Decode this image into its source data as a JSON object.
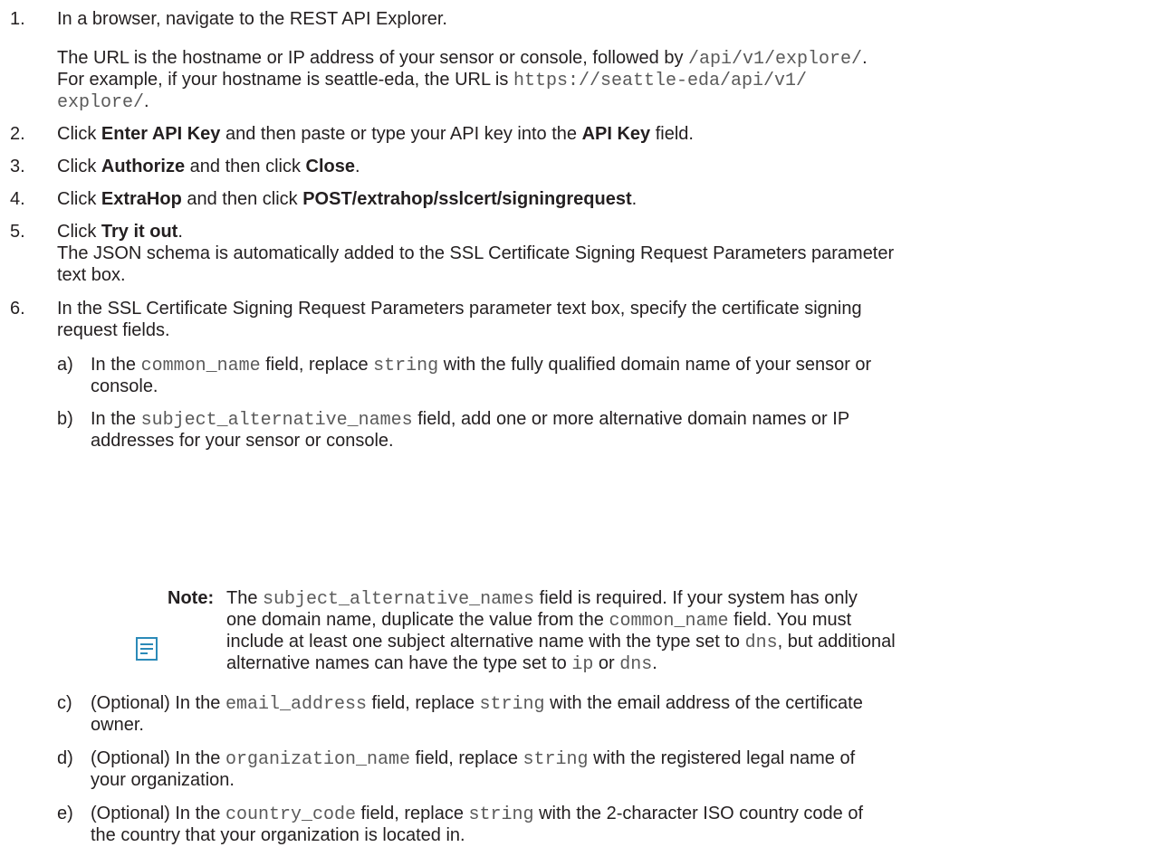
{
  "steps": {
    "s1": {
      "num": "1.",
      "text": "In a browser, navigate to the REST API Explorer.",
      "para1_pre": "The URL is the hostname or IP address of your sensor or console, followed by ",
      "para1_code": "/api/v1/explore/",
      "para1_post": ".",
      "para2_pre": "For example, if your hostname is seattle-eda, the URL is ",
      "para2_code1": "https://seattle-eda/api/v1/",
      "para2_code2": "explore/",
      "para2_post": "."
    },
    "s2": {
      "num": "2.",
      "t1": "Click ",
      "b1": "Enter API Key",
      "t2": " and then paste or type your API key into the ",
      "b2": "API Key",
      "t3": " field."
    },
    "s3": {
      "num": "3.",
      "t1": "Click ",
      "b1": "Authorize",
      "t2": " and then click ",
      "b2": "Close",
      "t3": "."
    },
    "s4": {
      "num": "4.",
      "t1": "Click ",
      "b1": "ExtraHop",
      "t2": " and then click ",
      "b2": "POST/extrahop/sslcert/signingrequest",
      "t3": "."
    },
    "s5": {
      "num": "5.",
      "t1": "Click ",
      "b1": "Try it out",
      "t2": ".",
      "line2": "The JSON schema is automatically added to the SSL Certificate Signing Request Parameters parameter",
      "line3": "text box."
    },
    "s6": {
      "num": "6.",
      "line1": "In the SSL Certificate Signing Request Parameters parameter text box, specify the certificate signing",
      "line2": "request fields."
    }
  },
  "substeps": {
    "a": {
      "label": "a)",
      "t1": "In the ",
      "c1": "common_name",
      "t2": " field, replace ",
      "c2": "string",
      "t3": " with the fully qualified domain name of your sensor or",
      "line2": "console."
    },
    "b": {
      "label": "b)",
      "t1": "In the ",
      "c1": "subject_alternative_names",
      "t2": " field, add one or more alternative domain names or IP",
      "line2": "addresses for your sensor or console."
    },
    "c": {
      "label": "c)",
      "t1": "(Optional) In the ",
      "c1": "email_address",
      "t2": " field, replace ",
      "c2": "string",
      "t3": " with the email address of the certificate",
      "line2": "owner."
    },
    "d": {
      "label": "d)",
      "t1": "(Optional) In the ",
      "c1": "organization_name",
      "t2": " field, replace ",
      "c2": "string",
      "t3": " with the registered legal name of",
      "line2": "your organization."
    },
    "e": {
      "label": "e)",
      "t1": "(Optional) In the ",
      "c1": "country_code",
      "t2": " field, replace ",
      "c2": "string",
      "t3": " with the 2-character ISO country code of",
      "line2": "the country that your organization is located in."
    }
  },
  "note": {
    "icon": "note-icon",
    "label": "Note:",
    "l1_t1": "The ",
    "l1_c1": "subject_alternative_names",
    "l1_t2": " field is required. If your system has only",
    "l2_t1": "one domain name, duplicate the value from the ",
    "l2_c1": "common_name",
    "l2_t2": " field. You must",
    "l3_t1": "include at least one subject alternative name with the type set to ",
    "l3_c1": "dns",
    "l3_t2": ", but additional",
    "l4_t1": "alternative names can have the type set to ",
    "l4_c1": "ip",
    "l4_t2": " or ",
    "l4_c2": "dns",
    "l4_t3": "."
  }
}
